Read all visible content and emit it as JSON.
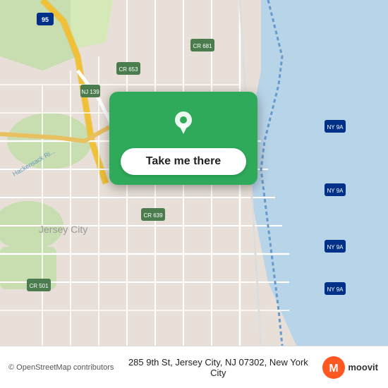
{
  "map": {
    "background_color": "#e8e0d8"
  },
  "location_card": {
    "button_label": "Take me there",
    "background_color": "#2eaa5a"
  },
  "bottom_bar": {
    "attribution": "© OpenStreetMap contributors",
    "address": "285 9th St, Jersey City, NJ 07302, New York City",
    "logo_label": "moovit"
  }
}
